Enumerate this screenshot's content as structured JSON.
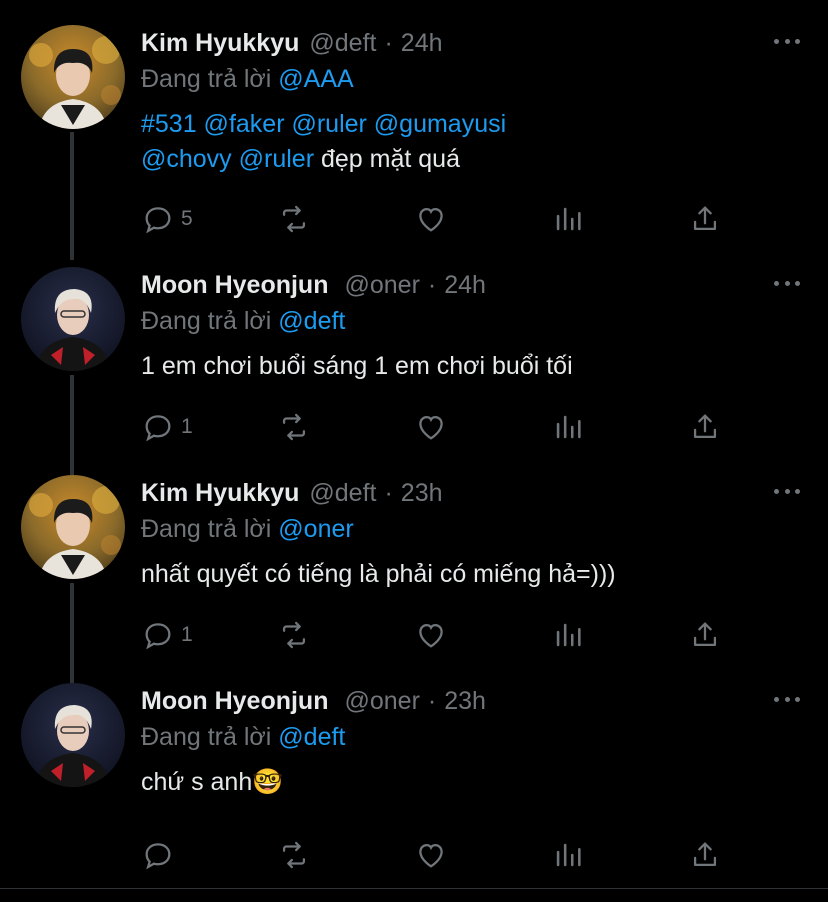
{
  "tweets": [
    {
      "name": "Kim Hyukkyu",
      "handle": "@deft",
      "time": "24h",
      "reply_prefix": "Đang trả lời",
      "reply_to": "@AAA",
      "text_parts": [
        {
          "t": "#531 @faker @ruler @gumayusi",
          "link": true
        },
        {
          "t": "@chovy @ruler",
          "link": true
        },
        {
          "t": " đẹp mặt quá",
          "link": false
        }
      ],
      "reply_count": "5",
      "avatar": "deft"
    },
    {
      "name": "Moon Hyeonjun",
      "handle": "@oner",
      "time": "24h",
      "reply_prefix": "Đang trả lời",
      "reply_to": "@deft",
      "text": "1 em chơi buổi sáng 1 em chơi buổi tối",
      "reply_count": "1",
      "avatar": "oner"
    },
    {
      "name": "Kim Hyukkyu",
      "handle": "@deft",
      "time": "23h",
      "reply_prefix": "Đang trả lời",
      "reply_to": "@oner",
      "text": "nhất quyết có tiếng là phải có miếng hả=)))",
      "reply_count": "1",
      "avatar": "deft"
    },
    {
      "name": "Moon Hyeonjun",
      "handle": "@oner",
      "time": "23h",
      "reply_prefix": "Đang trả lời",
      "reply_to": "@deft",
      "text": "chứ s anh🤓",
      "reply_count": "",
      "avatar": "oner"
    }
  ],
  "icons": {
    "reply": "reply-icon",
    "retweet": "retweet-icon",
    "like": "heart-icon",
    "views": "views-icon",
    "share": "share-icon",
    "more": "more-icon"
  },
  "colors": {
    "background": "#000000",
    "text": "#e7e9ea",
    "muted": "#71767b",
    "link": "#1d9bf0",
    "line": "#2f3336"
  }
}
